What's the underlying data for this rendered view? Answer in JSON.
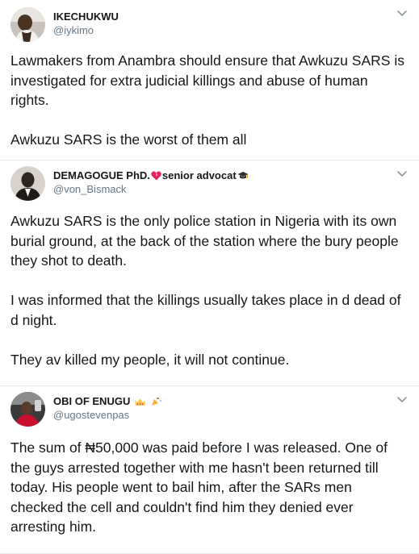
{
  "tweets": [
    {
      "display_name": "IKECHUKWU",
      "handle": "@iykimo",
      "paragraphs": [
        "Lawmakers from Anambra should ensure that Awkuzu SARS is investigated for extra judicial killings and abuse of human rights.",
        "Awkuzu SARS is the worst of them all"
      ]
    },
    {
      "display_name": "DEMAGOGUE PhD.",
      "display_name_suffix": "senior advocat",
      "handle": "@von_Bismack",
      "paragraphs": [
        "Awkuzu SARS is the only police station in Nigeria with its own burial ground, at the back of the station where the bury people they shot to death.",
        "I was informed that the killings usually takes place in d dead of d night.",
        "They av killed my people, it will not continue."
      ]
    },
    {
      "display_name": "OBI OF ENUGU",
      "handle": "@ugostevenpas",
      "paragraphs": [
        "The sum of ₦50,000 was paid before I was released. One of the guys arrested together with me hasn't been returned till today. His people went to bail him, after the SARs men checked the cell and couldn't find him they denied ever arresting him."
      ]
    }
  ],
  "icons": {
    "menu": "chevron-down-icon",
    "heart": "broken-heart-icon",
    "cap": "graduation-cap-icon",
    "crown": "crown-icon",
    "party": "party-popper-icon"
  },
  "colors": {
    "text": "#14171a",
    "secondary": "#657786",
    "divider": "#e6ecf0"
  }
}
